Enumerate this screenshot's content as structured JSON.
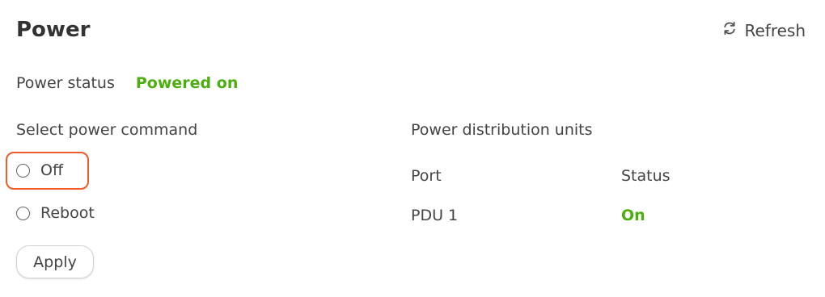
{
  "page": {
    "title": "Power",
    "refresh_label": "Refresh"
  },
  "power_status": {
    "label": "Power status",
    "value": "Powered on",
    "color": "#4caf0f"
  },
  "power_command": {
    "label": "Select power command",
    "options": [
      {
        "label": "Off",
        "selected": false
      },
      {
        "label": "Reboot",
        "selected": false
      }
    ],
    "apply_label": "Apply"
  },
  "pdu": {
    "label": "Power distribution units",
    "columns": [
      "Port",
      "Status"
    ],
    "rows": [
      {
        "port": "PDU 1",
        "status": "On",
        "status_color": "#4caf0f"
      }
    ]
  },
  "icons": {
    "refresh": "refresh-icon"
  },
  "colors": {
    "highlight": "#f05a28",
    "success": "#4caf0f"
  }
}
